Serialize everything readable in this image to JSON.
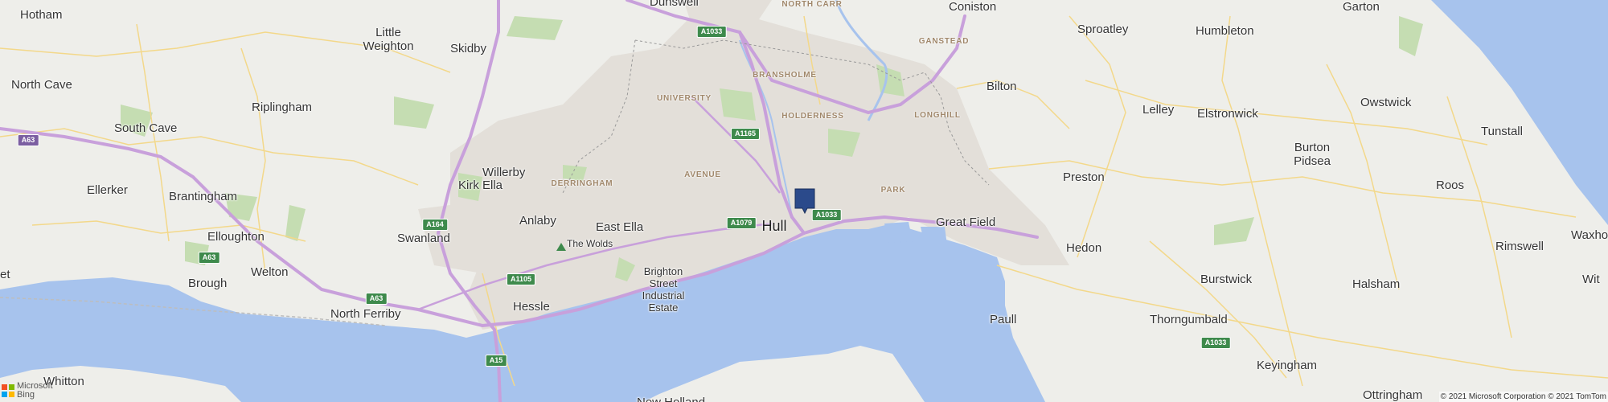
{
  "map": {
    "colors": {
      "water": "#a7c3ed",
      "land": "#eeeeea",
      "urban": "#e2ddd8",
      "park": "#b9d9a1",
      "motorway": "#c59ad8",
      "road": "#f5d785"
    },
    "places": {
      "hotham": "Hotham",
      "little_weighton": "Little\nWeighton",
      "skidby": "Skidby",
      "dunswell": "Dunswell",
      "coniston": "Coniston",
      "sproatley": "Sproatley",
      "humbleton": "Humbleton",
      "garton": "Garton",
      "north_cave": "North Cave",
      "riplingham": "Riplingham",
      "bilton": "Bilton",
      "lelley": "Lelley",
      "elstronwick": "Elstronwick",
      "owstwick": "Owstwick",
      "tunstall": "Tunstall",
      "south_cave": "South Cave",
      "burton_pidsea": "Burton\nPidsea",
      "willerby": "Willerby",
      "kirk_ella": "Kirk Ella",
      "ellerker": "Ellerker",
      "brantingham": "Brantingham",
      "preston": "Preston",
      "roos": "Roos",
      "anlaby": "Anlaby",
      "east_ella": "East Ella",
      "great_field": "Great Field",
      "elloughton": "Elloughton",
      "swanland": "Swanland",
      "the_wolds": "The Wolds",
      "hedon": "Hedon",
      "rimswell": "Rimswell",
      "waxholme": "Waxho",
      "withernsea": "Wit",
      "brough": "Brough",
      "welton": "Welton",
      "brighton_street": "Brighton\nStreet\nIndustrial\nEstate",
      "burstwick": "Burstwick",
      "halsham": "Halsham",
      "hessle": "Hessle",
      "north_ferriby": "North Ferriby",
      "paull": "Paull",
      "thorngumbald": "Thorngumbald",
      "keyingham": "Keyingham",
      "whitton": "Whitton",
      "ottringham": "Ottringham",
      "new_holland": "New Holland",
      "et": "et"
    },
    "city": "Hull",
    "districts": {
      "north_carr": "NORTH CARR",
      "bransholme": "BRANSHOLME",
      "ganstead": "GANSTEAD",
      "university": "UNIVERSITY",
      "holderness": "HOLDERNESS",
      "longhill": "LONGHILL",
      "avenue": "AVENUE",
      "derringham": "DERRINGHAM",
      "park": "PARK"
    },
    "shields": {
      "a1033_n": "A1033",
      "a1165": "A1165",
      "a1033_c": "A1033",
      "a1079": "A1079",
      "a164": "A164",
      "a63_w": "A63",
      "a63_s": "A63",
      "a63_e": "A63",
      "a1105": "A1105",
      "a15": "A15",
      "a1033_se": "A1033"
    },
    "attribution": "© 2021 Microsoft Corporation © 2021 TomTom",
    "logo": {
      "line1": "Microsoft",
      "line2": "Bing"
    },
    "pin_icon": "location-pin-icon"
  }
}
